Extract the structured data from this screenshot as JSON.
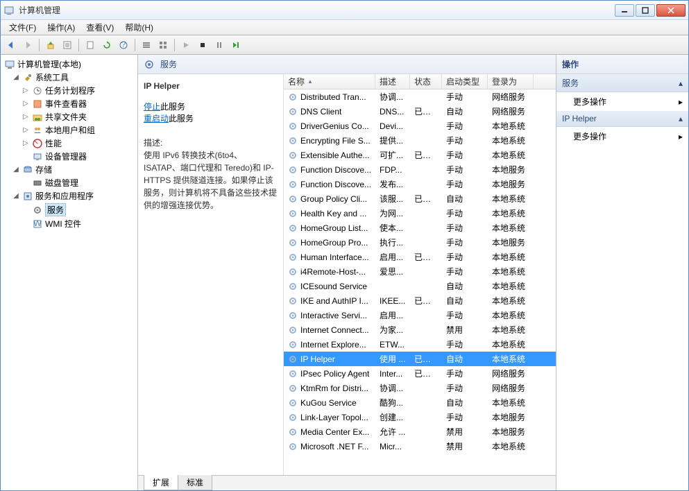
{
  "window": {
    "title": "计算机管理"
  },
  "menu": {
    "file": "文件(F)",
    "action": "操作(A)",
    "view": "查看(V)",
    "help": "帮助(H)"
  },
  "tree": {
    "root": "计算机管理(本地)",
    "sys_tools": "系统工具",
    "task_sched": "任务计划程序",
    "event_viewer": "事件查看器",
    "shared_folders": "共享文件夹",
    "local_users": "本地用户和组",
    "performance": "性能",
    "device_mgr": "设备管理器",
    "storage": "存储",
    "disk_mgmt": "磁盘管理",
    "services_apps": "服务和应用程序",
    "services": "服务",
    "wmi": "WMI 控件"
  },
  "center": {
    "header": "服务",
    "selected_title": "IP Helper",
    "stop_label": "停止",
    "stop_suffix": "此服务",
    "restart_label": "重启动",
    "restart_suffix": "此服务",
    "desc_label": "描述:",
    "desc_text": "使用 IPv6 转换技术(6to4、ISATAP、端口代理和 Teredo)和 IP-HTTPS 提供隧道连接。如果停止该服务，则计算机将不具备这些技术提供的增强连接优势。"
  },
  "columns": {
    "name": "名称",
    "desc": "描述",
    "status": "状态",
    "start": "启动类型",
    "logon": "登录为"
  },
  "rows": [
    {
      "name": "Distributed Tran...",
      "desc": "协调...",
      "status": "",
      "start": "手动",
      "logon": "网络服务",
      "sel": false
    },
    {
      "name": "DNS Client",
      "desc": "DNS...",
      "status": "已启动",
      "start": "自动",
      "logon": "网络服务",
      "sel": false
    },
    {
      "name": "DriverGenius Co...",
      "desc": "Devi...",
      "status": "",
      "start": "手动",
      "logon": "本地系统",
      "sel": false
    },
    {
      "name": "Encrypting File S...",
      "desc": "提供...",
      "status": "",
      "start": "手动",
      "logon": "本地系统",
      "sel": false
    },
    {
      "name": "Extensible Authe...",
      "desc": "可扩...",
      "status": "已启动",
      "start": "手动",
      "logon": "本地系统",
      "sel": false
    },
    {
      "name": "Function Discove...",
      "desc": "FDP...",
      "status": "",
      "start": "手动",
      "logon": "本地服务",
      "sel": false
    },
    {
      "name": "Function Discove...",
      "desc": "发布...",
      "status": "",
      "start": "手动",
      "logon": "本地服务",
      "sel": false
    },
    {
      "name": "Group Policy Cli...",
      "desc": "该服...",
      "status": "已启动",
      "start": "自动",
      "logon": "本地系统",
      "sel": false
    },
    {
      "name": "Health Key and ...",
      "desc": "为网...",
      "status": "",
      "start": "手动",
      "logon": "本地系统",
      "sel": false
    },
    {
      "name": "HomeGroup List...",
      "desc": "使本...",
      "status": "",
      "start": "手动",
      "logon": "本地系统",
      "sel": false
    },
    {
      "name": "HomeGroup Pro...",
      "desc": "执行...",
      "status": "",
      "start": "手动",
      "logon": "本地服务",
      "sel": false
    },
    {
      "name": "Human Interface...",
      "desc": "启用...",
      "status": "已启动",
      "start": "手动",
      "logon": "本地系统",
      "sel": false
    },
    {
      "name": "i4Remote-Host-...",
      "desc": "爱思...",
      "status": "",
      "start": "手动",
      "logon": "本地系统",
      "sel": false
    },
    {
      "name": "ICEsound Service",
      "desc": "",
      "status": "",
      "start": "自动",
      "logon": "本地系统",
      "sel": false
    },
    {
      "name": "IKE and AuthIP I...",
      "desc": "IKEE...",
      "status": "已启动",
      "start": "自动",
      "logon": "本地系统",
      "sel": false
    },
    {
      "name": "Interactive Servi...",
      "desc": "启用...",
      "status": "",
      "start": "手动",
      "logon": "本地系统",
      "sel": false
    },
    {
      "name": "Internet Connect...",
      "desc": "为家...",
      "status": "",
      "start": "禁用",
      "logon": "本地系统",
      "sel": false
    },
    {
      "name": "Internet Explore...",
      "desc": "ETW...",
      "status": "",
      "start": "手动",
      "logon": "本地系统",
      "sel": false
    },
    {
      "name": "IP Helper",
      "desc": "使用 ...",
      "status": "已启动",
      "start": "自动",
      "logon": "本地系统",
      "sel": true
    },
    {
      "name": "IPsec Policy Agent",
      "desc": "Inter...",
      "status": "已启动",
      "start": "手动",
      "logon": "网络服务",
      "sel": false
    },
    {
      "name": "KtmRm for Distri...",
      "desc": "协调...",
      "status": "",
      "start": "手动",
      "logon": "网络服务",
      "sel": false
    },
    {
      "name": "KuGou Service",
      "desc": "酷狗...",
      "status": "",
      "start": "自动",
      "logon": "本地系统",
      "sel": false
    },
    {
      "name": "Link-Layer Topol...",
      "desc": "创建...",
      "status": "",
      "start": "手动",
      "logon": "本地服务",
      "sel": false
    },
    {
      "name": "Media Center Ex...",
      "desc": "允许 ...",
      "status": "",
      "start": "禁用",
      "logon": "本地服务",
      "sel": false
    },
    {
      "name": "Microsoft .NET F...",
      "desc": "Micr...",
      "status": "",
      "start": "禁用",
      "logon": "本地系统",
      "sel": false
    }
  ],
  "tabs": {
    "extended": "扩展",
    "standard": "标准"
  },
  "actions": {
    "header": "操作",
    "group1": "服务",
    "more_actions": "更多操作",
    "group2": "IP Helper"
  }
}
